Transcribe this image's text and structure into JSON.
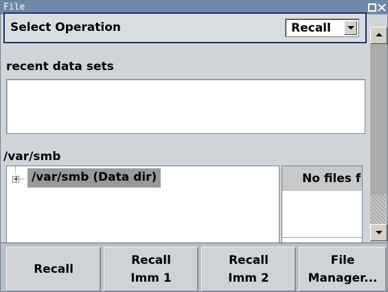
{
  "window": {
    "title": "File"
  },
  "operation": {
    "label": "Select Operation",
    "selected": "Recall"
  },
  "recent": {
    "label": "recent data sets"
  },
  "directory": {
    "path": "/var/smb",
    "tree_node": "/var/smb (Data dir)"
  },
  "files": {
    "header": "No files f"
  },
  "softkeys": [
    {
      "label": "Recall"
    },
    {
      "label": "Recall\nImm 1"
    },
    {
      "label": "Recall\nImm 2"
    },
    {
      "label": "File\nManager..."
    }
  ],
  "icons": {
    "restore": "restore-icon",
    "close": "close-icon",
    "dropdown": "chevron-down-icon",
    "scroll_up": "arrow-up-icon",
    "scroll_down": "arrow-down-icon",
    "expander": "plus-icon"
  }
}
